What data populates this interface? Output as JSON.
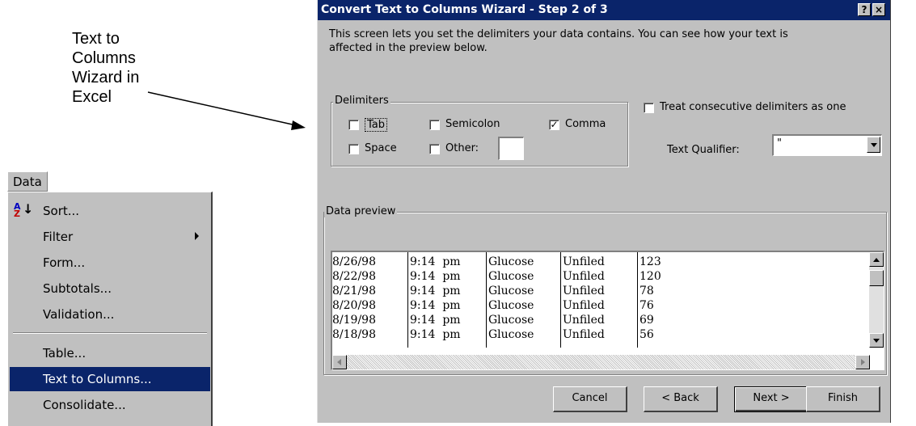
{
  "callout": {
    "lines": [
      "Text to",
      "Columns",
      "Wizard in",
      "Excel"
    ]
  },
  "menu": {
    "title": "Data",
    "items": [
      {
        "label": "Sort...",
        "icon": "sort-az-icon"
      },
      {
        "label": "Filter",
        "submenu": true
      },
      {
        "label": "Form..."
      },
      {
        "label": "Subtotals..."
      },
      {
        "label": "Validation..."
      },
      {
        "label": "Table..."
      },
      {
        "label": "Text to Columns...",
        "selected": true
      },
      {
        "label": "Consolidate..."
      }
    ]
  },
  "dialog": {
    "title": "Convert Text to Columns Wizard - Step 2 of 3",
    "help_label": "?",
    "close_label": "×",
    "intro": "This screen lets you set the delimiters your data contains.  You can see how your text is affected in the preview below.",
    "delimiters_label": "Delimiters",
    "delimiters": {
      "tab": {
        "label": "Tab",
        "checked": false
      },
      "semicolon": {
        "label": "Semicolon",
        "checked": false
      },
      "comma": {
        "label": "Comma",
        "checked": true
      },
      "space": {
        "label": "Space",
        "checked": false
      },
      "other": {
        "label": "Other:",
        "checked": false,
        "value": ""
      }
    },
    "consecutive": {
      "label": "Treat consecutive delimiters as one",
      "checked": false
    },
    "text_qualifier": {
      "label": "Text Qualifier:",
      "value": "\""
    },
    "preview_label": "Data preview",
    "preview_rows": [
      [
        "8/26/98",
        "9:14  pm",
        "Glucose",
        "Unfiled",
        "123"
      ],
      [
        "8/22/98",
        "9:14  pm",
        "Glucose",
        "Unfiled",
        "120"
      ],
      [
        "8/21/98",
        "9:14  pm",
        "Glucose",
        "Unfiled",
        "78"
      ],
      [
        "8/20/98",
        "9:14  pm",
        "Glucose",
        "Unfiled",
        "76"
      ],
      [
        "8/19/98",
        "9:14  pm",
        "Glucose",
        "Unfiled",
        "69"
      ],
      [
        "8/18/98",
        "9:14  pm",
        "Glucose",
        "Unfiled",
        "56"
      ]
    ],
    "buttons": {
      "cancel": "Cancel",
      "back": "< Back",
      "next": "Next >",
      "finish": "Finish"
    }
  }
}
